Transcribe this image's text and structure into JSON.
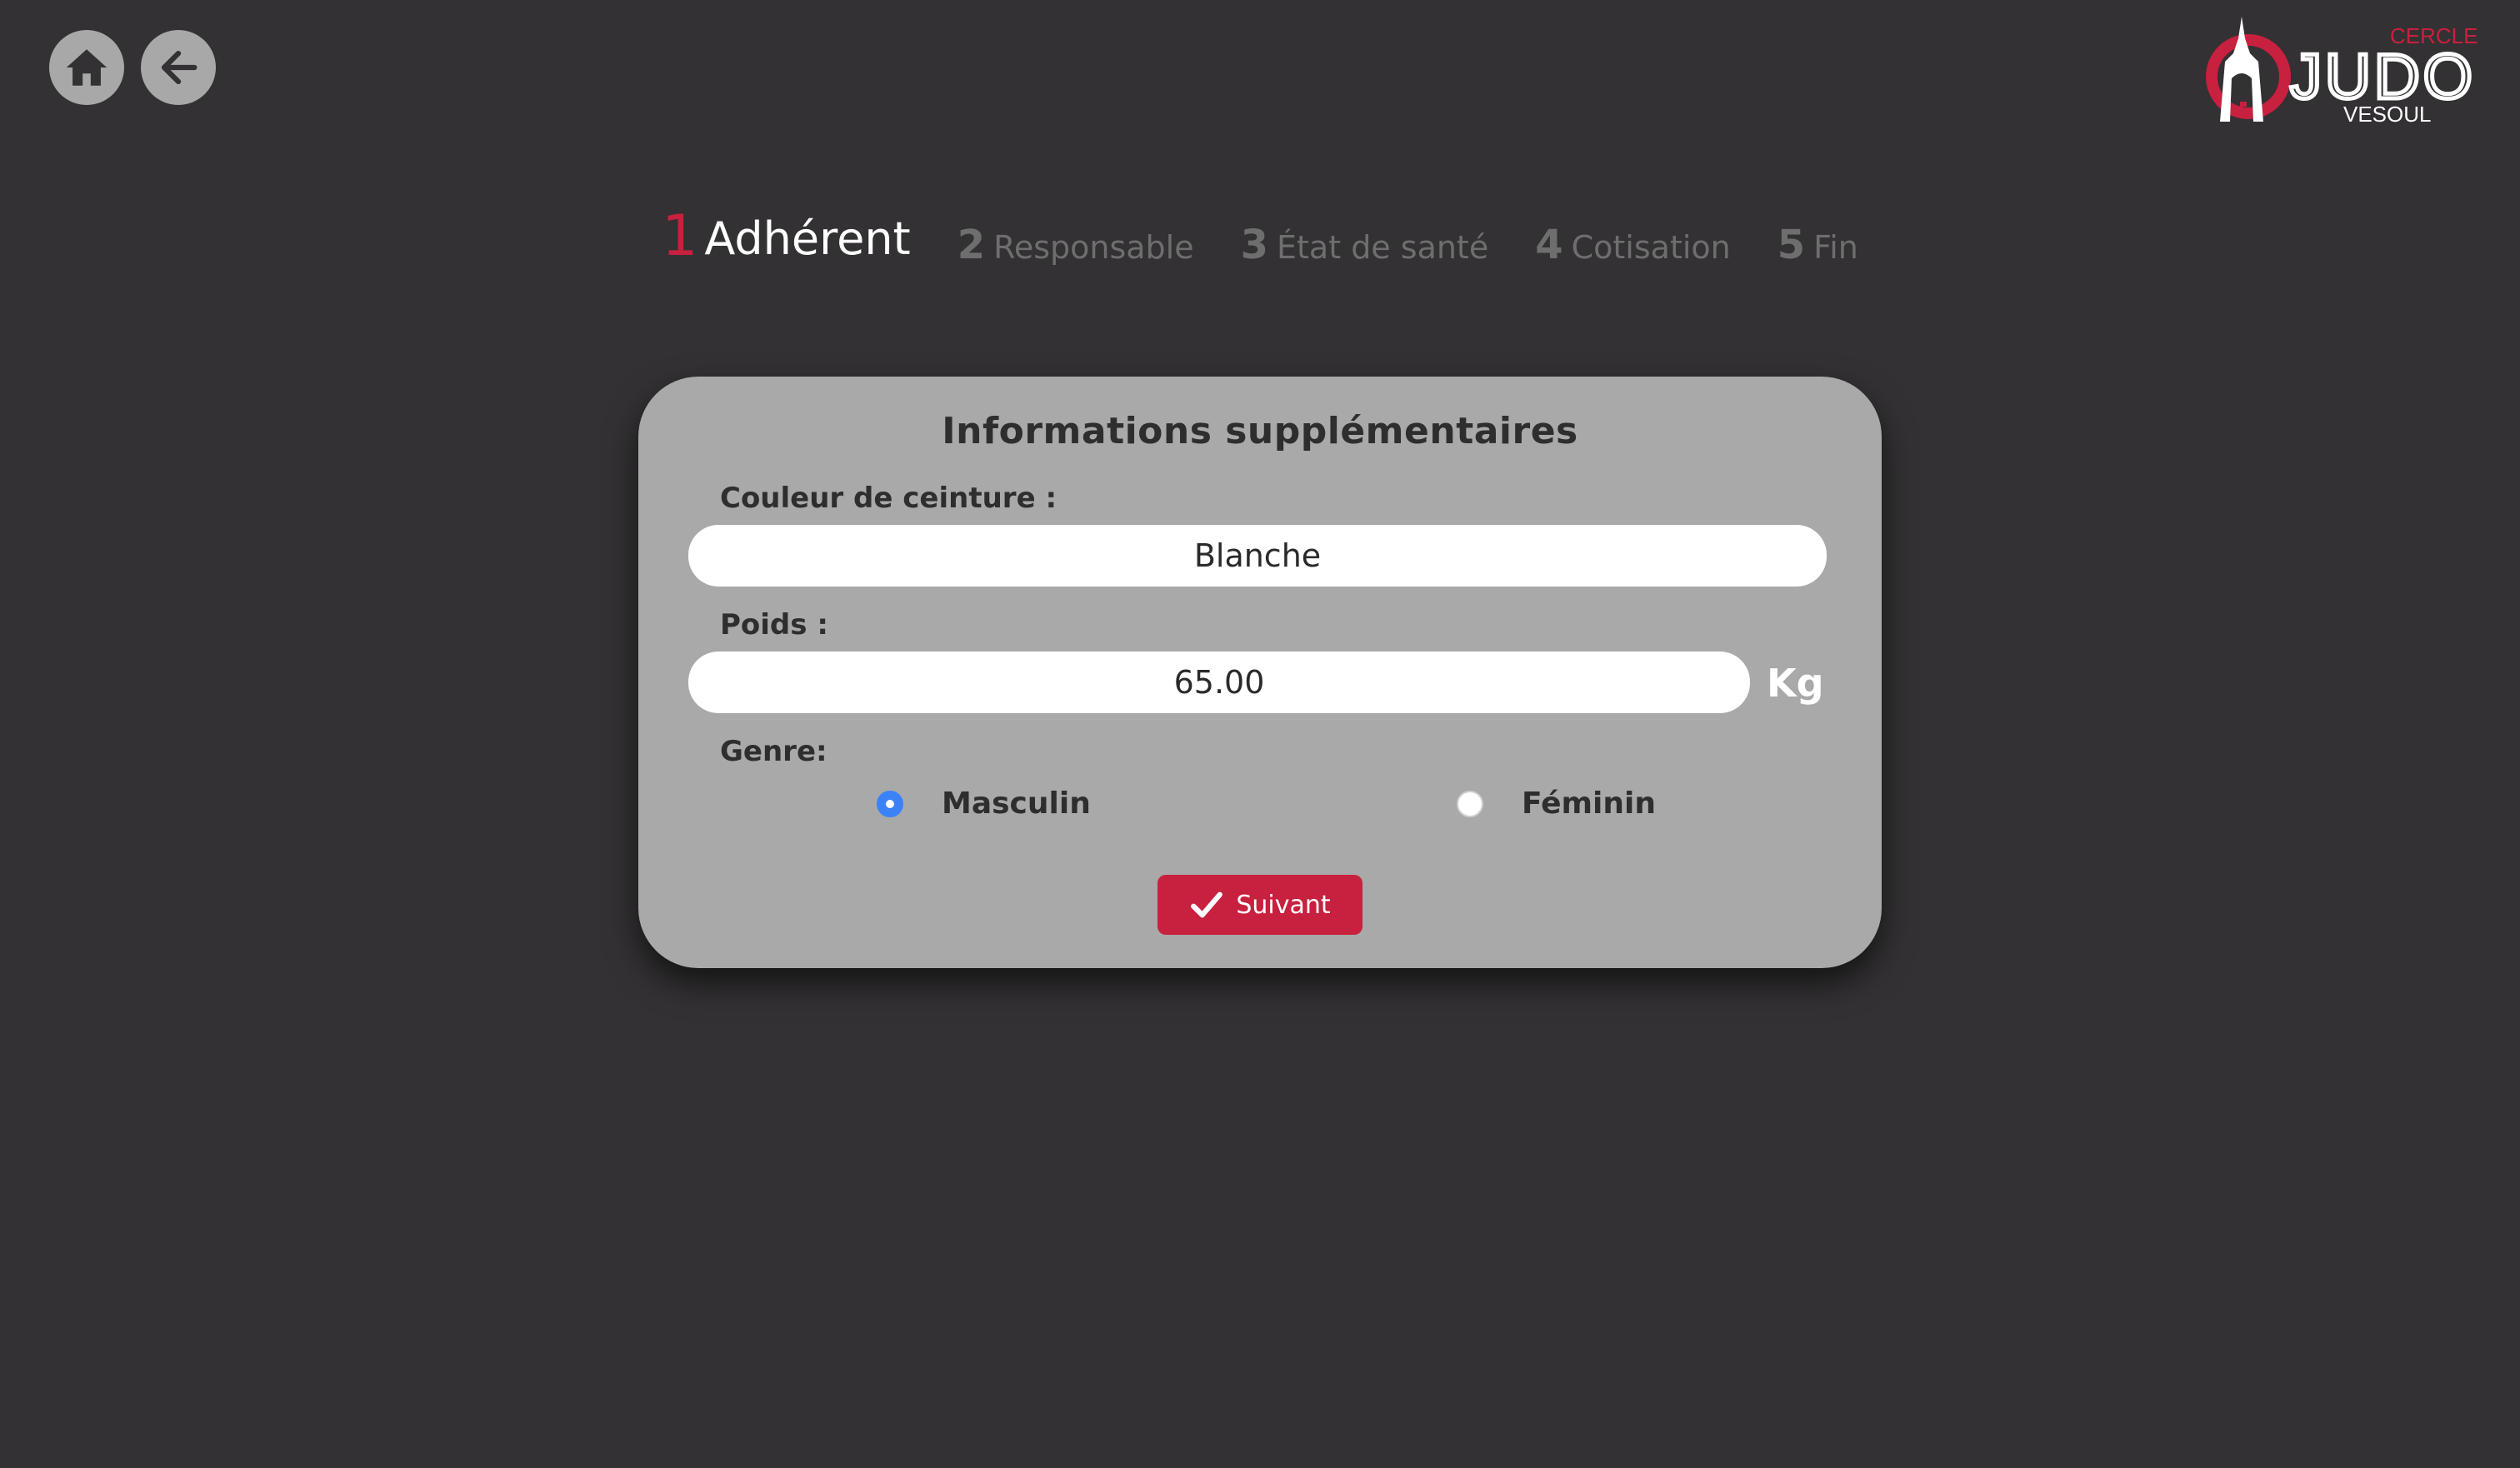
{
  "nav": {
    "home_icon": "home-icon",
    "back_icon": "arrow-left-icon"
  },
  "logo": {
    "top": "CERCLE",
    "main": "JUDO",
    "bottom": "VESOUL"
  },
  "steps": [
    {
      "num": "1",
      "label": "Adhérent",
      "active": true
    },
    {
      "num": "2",
      "label": "Responsable",
      "active": false
    },
    {
      "num": "3",
      "label": "État de santé",
      "active": false
    },
    {
      "num": "4",
      "label": "Cotisation",
      "active": false
    },
    {
      "num": "5",
      "label": "Fin",
      "active": false
    }
  ],
  "form": {
    "title": "Informations supplémentaires",
    "belt_label": "Couleur de ceinture :",
    "belt_value": "Blanche",
    "weight_label": "Poids :",
    "weight_value": "65.00",
    "weight_unit": "Kg",
    "genre_label": "Genre:",
    "genre_options": [
      "Masculin",
      "Féminin"
    ],
    "genre_selected": "Masculin",
    "submit_label": "Suivant"
  },
  "colors": {
    "background": "#333133",
    "card": "#a9a9a9",
    "accent": "#c8203f",
    "radio_selected": "#3b82f6"
  }
}
